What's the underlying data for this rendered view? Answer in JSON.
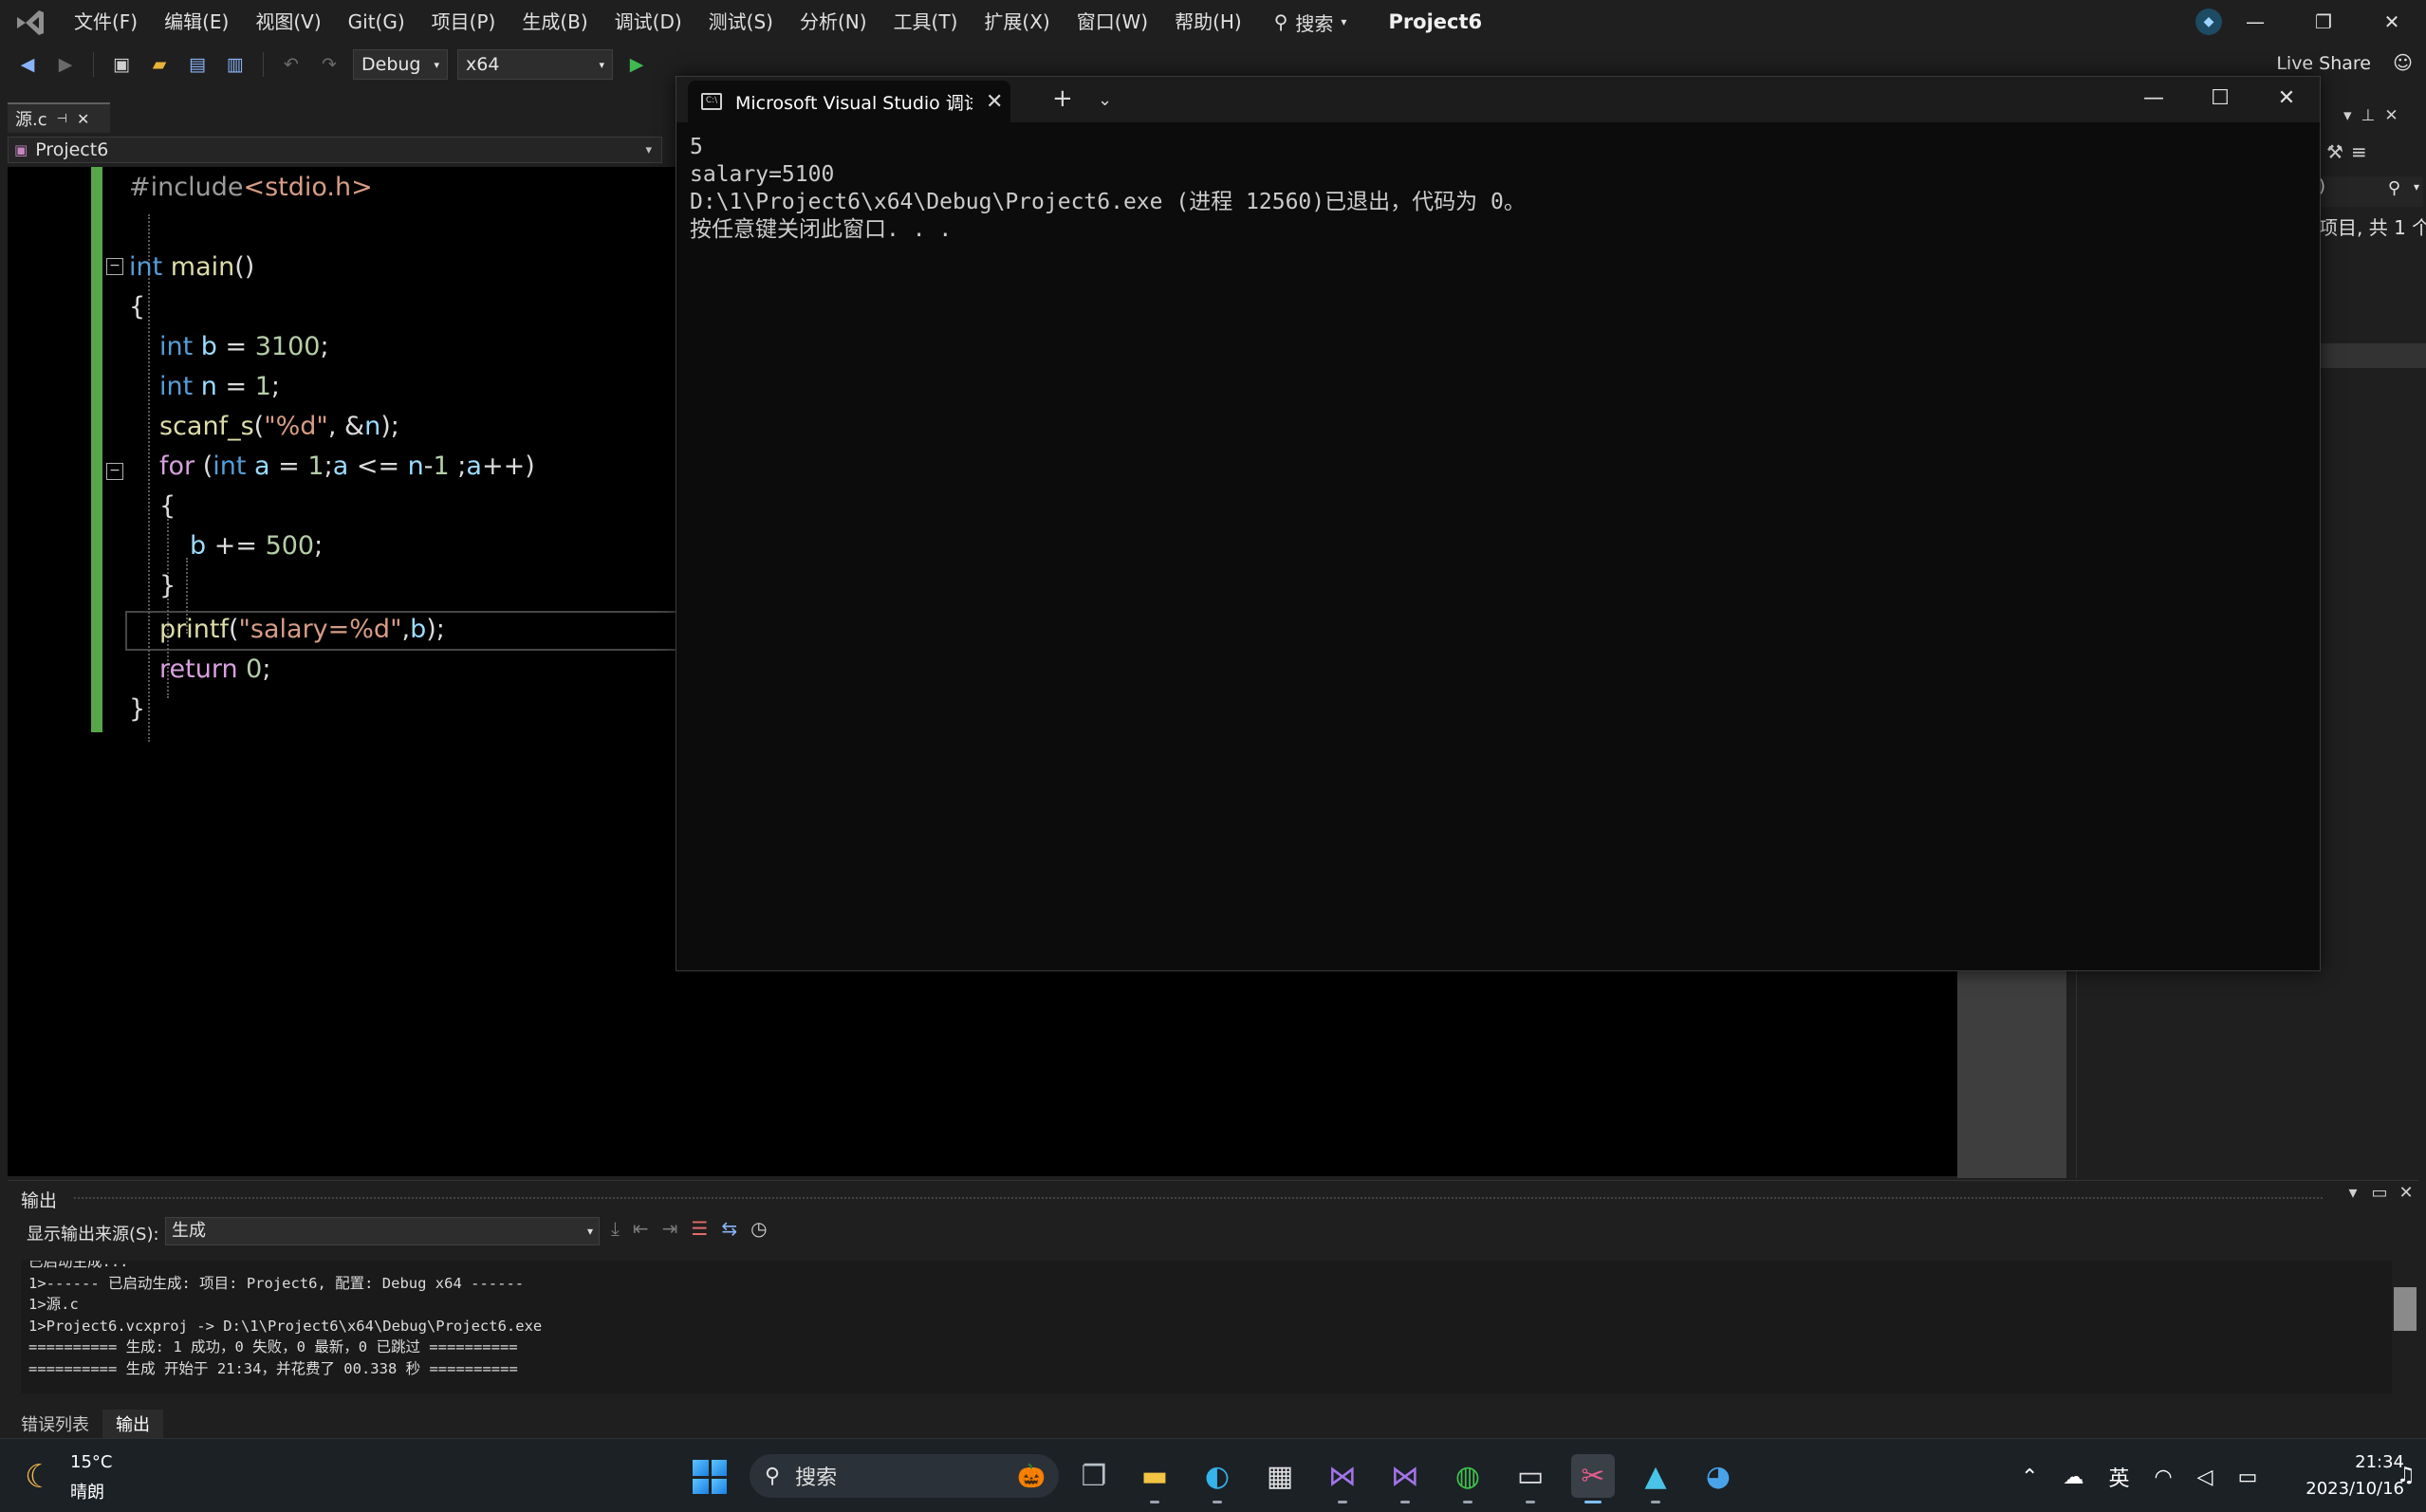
{
  "menubar": {
    "items": [
      "文件(F)",
      "编辑(E)",
      "视图(V)",
      "Git(G)",
      "项目(P)",
      "生成(B)",
      "调试(D)",
      "测试(S)",
      "分析(N)",
      "工具(T)",
      "扩展(X)",
      "窗口(W)",
      "帮助(H)"
    ],
    "search_label": "搜索",
    "project": "Project6"
  },
  "toolbar": {
    "config": "Debug",
    "platform": "x64",
    "live_share": "Live Share"
  },
  "editor": {
    "tab_label": "源.c",
    "nav_project": "Project6",
    "code": {
      "include_kw": "#include",
      "include_file": "<stdio.h>",
      "l3_type": "int",
      "l3_name": "main",
      "l3_rest": "()",
      "l4": "{",
      "l5_type": "int",
      "l5_var": "b",
      "l5_op": " = ",
      "l5_num": "3100",
      "l5_end": ";",
      "l6_type": "int",
      "l6_var": "n",
      "l6_op": " = ",
      "l6_num": "1",
      "l6_end": ";",
      "l7_fn": "scanf_s",
      "l7_open": "(",
      "l7_str": "\"%d\"",
      "l7_mid": ", &",
      "l7_var": "n",
      "l7_end": ");",
      "l8_kw": "for",
      "l8_a": " (",
      "l8_type": "int",
      "l8_v1": "a",
      "l8_b": " = ",
      "l8_n1": "1",
      "l8_c": ";",
      "l8_v2": "a",
      "l8_d": " <= ",
      "l8_v3": "n",
      "l8_e": "-",
      "l8_n2": "1",
      "l8_f": " ;",
      "l8_v4": "a",
      "l8_g": "++)",
      "l9": "{",
      "l10_var": "b",
      "l10_op": " += ",
      "l10_num": "500",
      "l10_end": ";",
      "l11": "}",
      "l12_fn": "printf",
      "l12_open": "(",
      "l12_str": "\"salary=%d\"",
      "l12_comma": ",",
      "l12_var": "b",
      "l12_end": ");",
      "l13_kw": "return",
      "l13_num": " 0",
      "l13_end": ";",
      "l14": "}"
    }
  },
  "right_pane": {
    "search_text": ")",
    "summary": "项目, 共 1 个"
  },
  "console": {
    "title": "Microsoft Visual Studio 调试控制台",
    "lines": [
      "5",
      "salary=5100",
      "D:\\1\\Project6\\x64\\Debug\\Project6.exe (进程 12560)已退出，代码为 0。",
      "按任意键关闭此窗口. . ."
    ]
  },
  "output": {
    "title": "输出",
    "source_label": "显示输出来源(S):",
    "source_value": "生成",
    "lines": [
      "已启动生成...",
      "1>------ 已启动生成: 项目: Project6, 配置: Debug x64 ------",
      "1>源.c",
      "1>Project6.vcxproj -> D:\\1\\Project6\\x64\\Debug\\Project6.exe",
      "========== 生成: 1 成功，0 失败，0 最新，0 已跳过 ==========",
      "========== 生成 开始于 21:34，并花费了 00.338 秒 =========="
    ]
  },
  "bottom_tabs": [
    "错误列表",
    "输出"
  ],
  "taskbar": {
    "temp": "15°C",
    "weather": "晴朗",
    "search": "搜索",
    "ime": "英",
    "time": "21:34",
    "date": "2023/10/16"
  },
  "colors": {
    "accent_green": "#57a64a",
    "keyword": "#569cd6",
    "control_keyword": "#d8a0df",
    "function": "#dcdcaa",
    "variable": "#9cdcfe",
    "number": "#b5cea8",
    "string": "#d69d85"
  }
}
